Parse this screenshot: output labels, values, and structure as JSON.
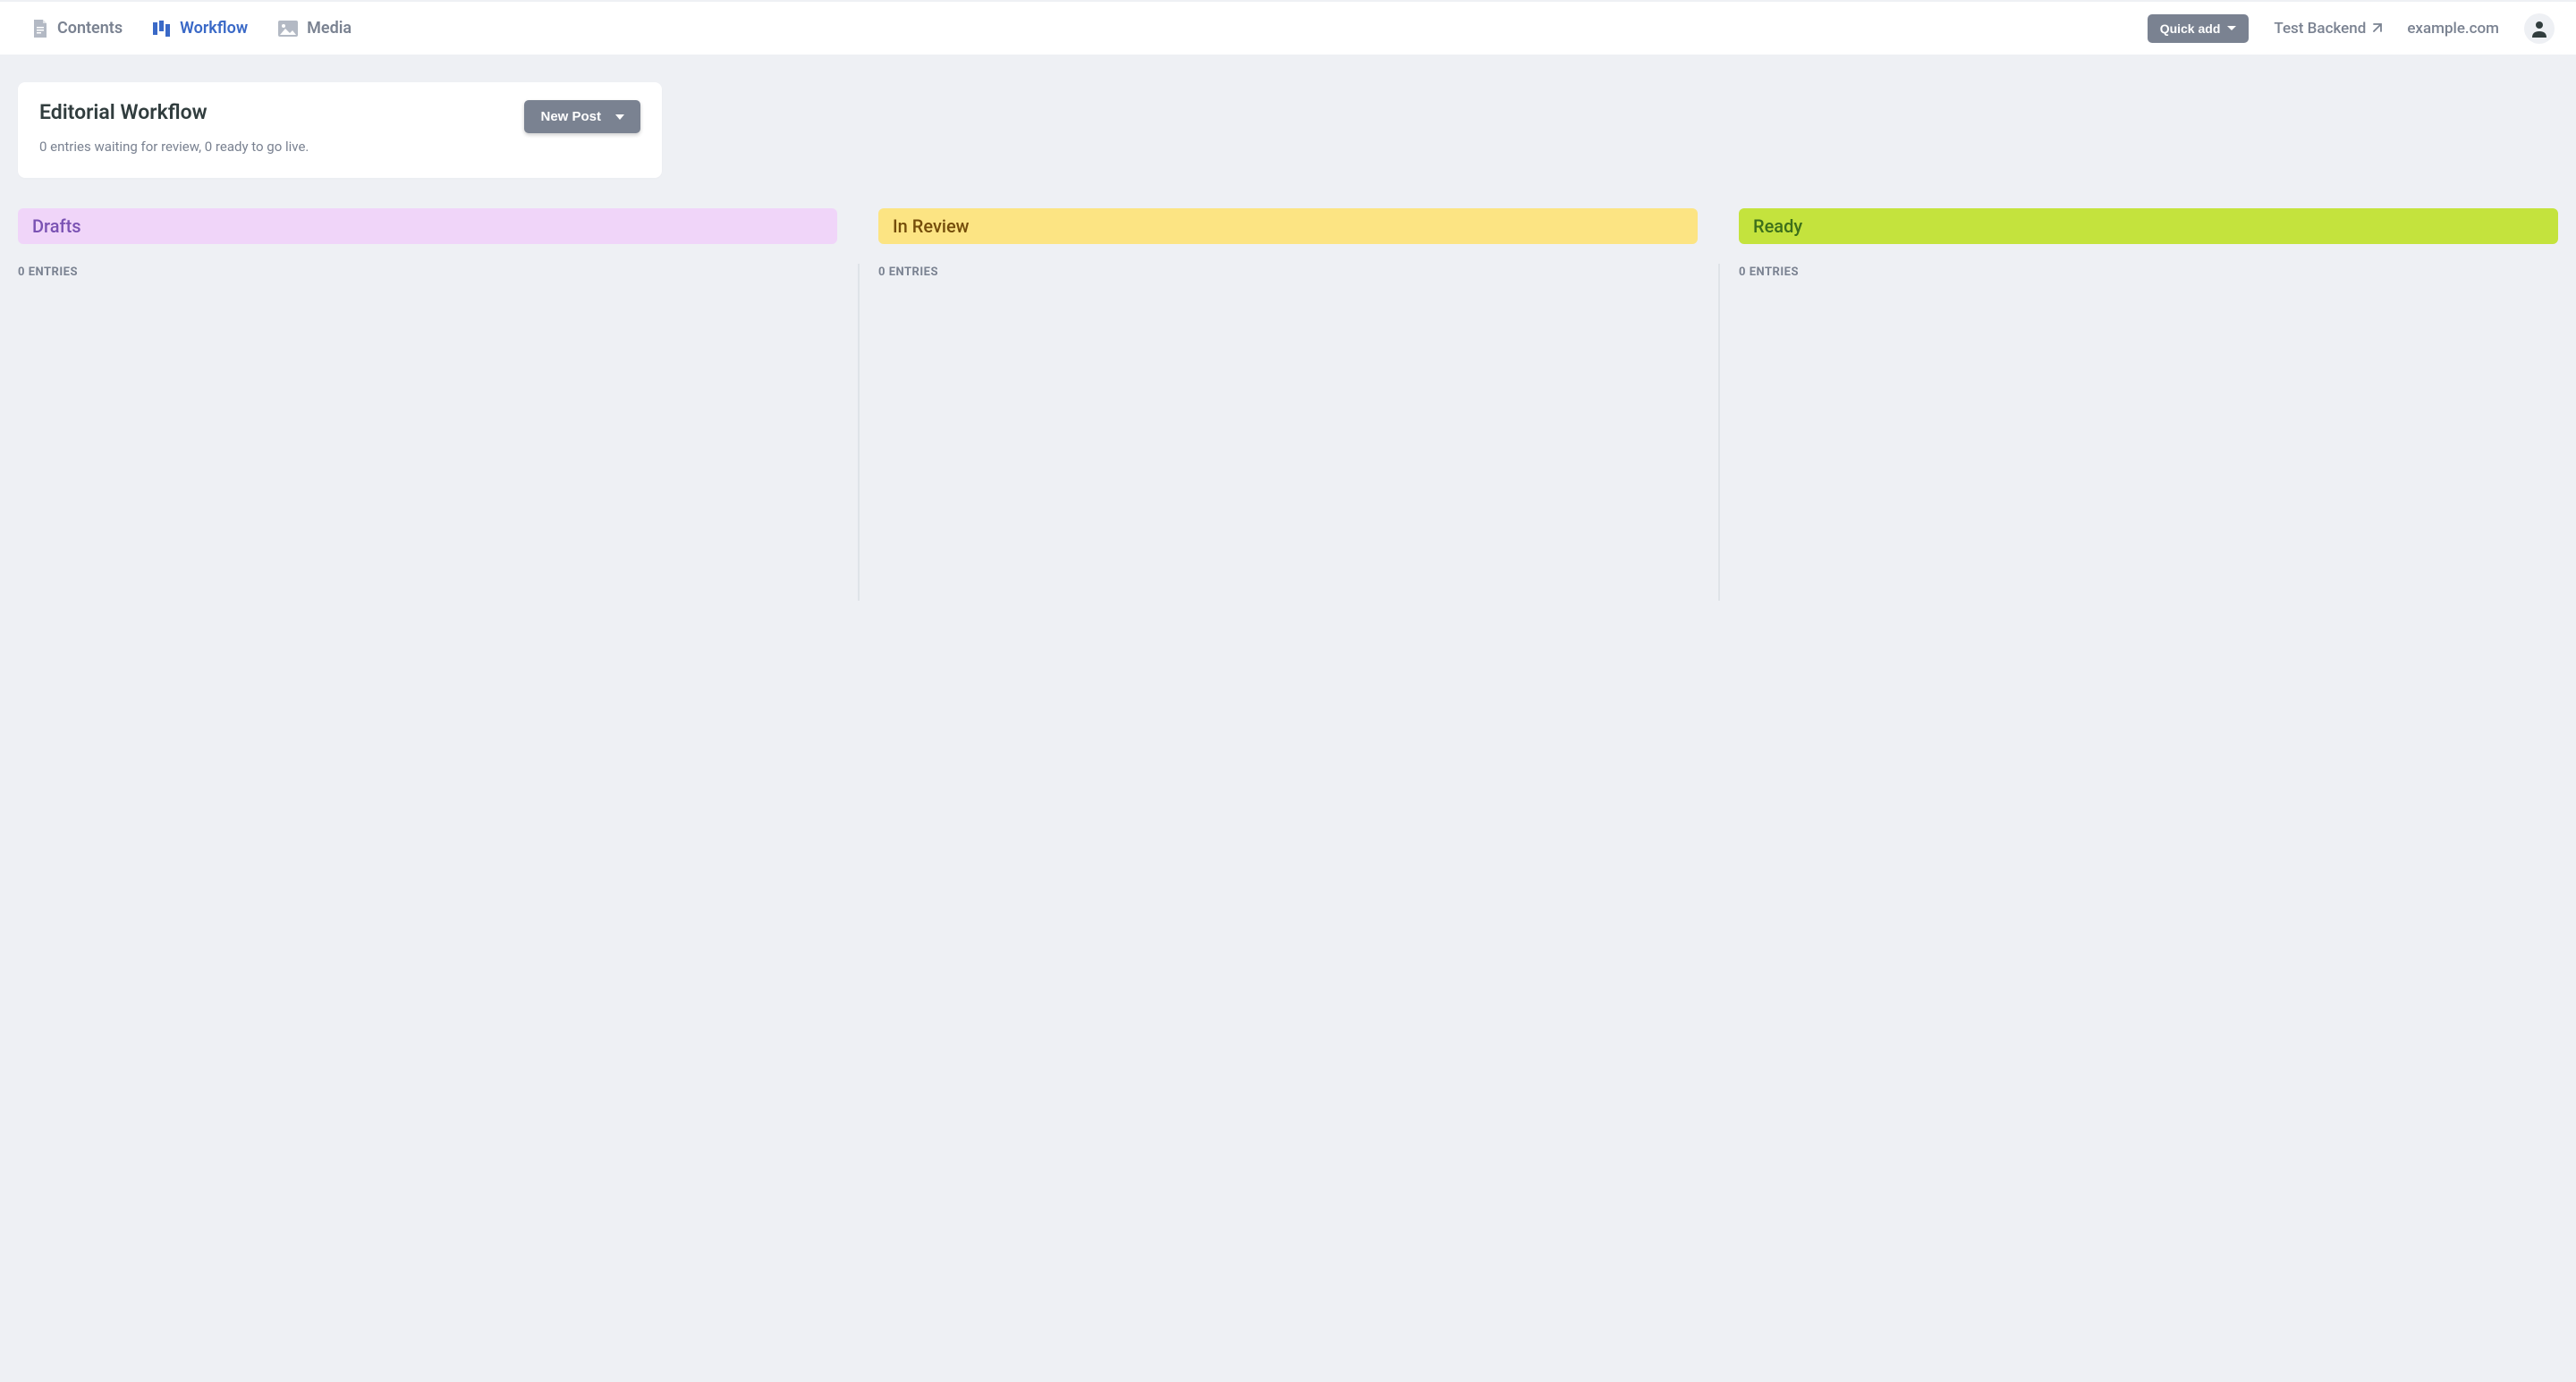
{
  "nav": {
    "contents": "Contents",
    "workflow": "Workflow",
    "media": "Media"
  },
  "topbar": {
    "quick_add": "Quick add",
    "test_backend": "Test Backend",
    "site_url": "example.com"
  },
  "header": {
    "title": "Editorial Workflow",
    "subtitle": "0 entries waiting for review, 0 ready to go live.",
    "new_post": "New Post"
  },
  "columns": {
    "drafts": {
      "title": "Drafts",
      "count": "0 ENTRIES"
    },
    "review": {
      "title": "In Review",
      "count": "0 ENTRIES"
    },
    "ready": {
      "title": "Ready",
      "count": "0 ENTRIES"
    }
  }
}
